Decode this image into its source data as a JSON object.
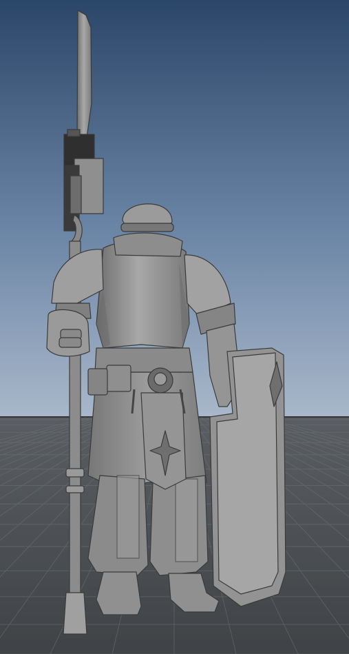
{
  "scene": {
    "kind": "3d-viewport-render",
    "subject": "armored-soldier-model",
    "shading": "untextured-gray",
    "colors": {
      "sky_top": "#2a4566",
      "sky_bottom": "#a7b6c8",
      "floor": "#474b4f",
      "grid_line": "#6b7075",
      "model_base": "#8a8a8a",
      "model_light": "#a9a9a9",
      "model_shadow": "#555555",
      "model_dark": "#2c2c2c"
    }
  }
}
